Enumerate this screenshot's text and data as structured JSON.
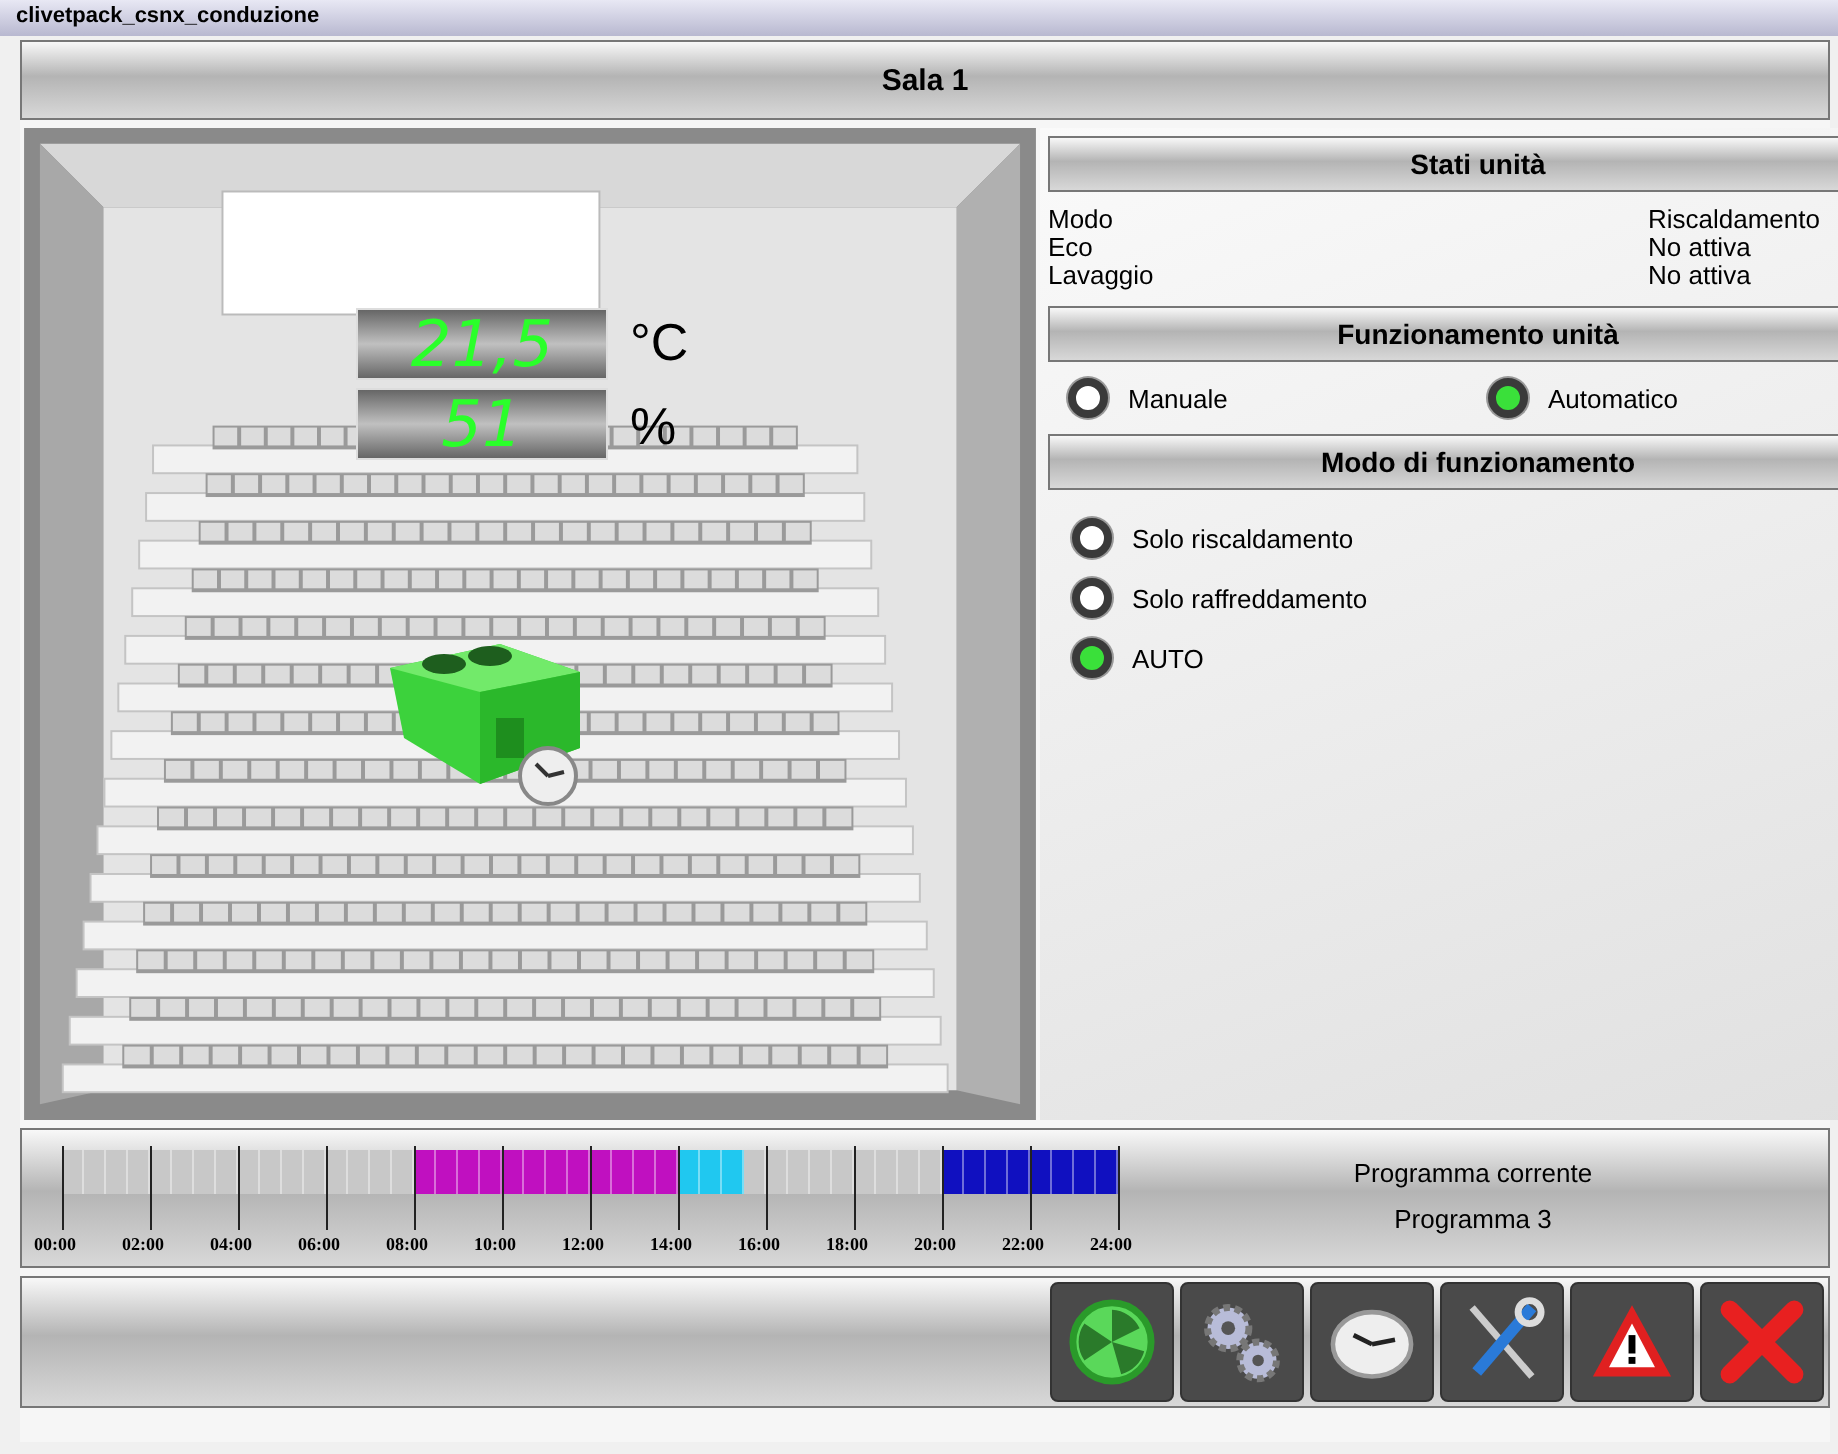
{
  "window": {
    "title": "clivetpack_csnx_conduzione"
  },
  "header": {
    "title": "Sala 1"
  },
  "room": {
    "temperature": {
      "value": "21,5",
      "unit": "°C"
    },
    "humidity": {
      "value": "51",
      "unit": "%"
    }
  },
  "unit_status": {
    "title": "Stati unità",
    "rows": [
      {
        "label": "Modo",
        "value": "Riscaldamento"
      },
      {
        "label": "Eco",
        "value": "No attiva"
      },
      {
        "label": "Lavaggio",
        "value": "No attiva"
      }
    ]
  },
  "unit_operation": {
    "title": "Funzionamento unità",
    "options": [
      {
        "label": "Manuale",
        "selected": false
      },
      {
        "label": "Automatico",
        "selected": true
      }
    ]
  },
  "operating_mode": {
    "title": "Modo di funzionamento",
    "options": [
      {
        "label": "Solo riscaldamento",
        "selected": false
      },
      {
        "label": "Solo raffreddamento",
        "selected": false
      },
      {
        "label": "AUTO",
        "selected": true
      }
    ]
  },
  "schedule": {
    "ticks": [
      "00:00",
      "02:00",
      "04:00",
      "06:00",
      "08:00",
      "10:00",
      "12:00",
      "14:00",
      "16:00",
      "18:00",
      "20:00",
      "22:00",
      "24:00"
    ],
    "slots": [
      {
        "color": "#c8c8c8"
      },
      {
        "color": "#c8c8c8"
      },
      {
        "color": "#c8c8c8"
      },
      {
        "color": "#c8c8c8"
      },
      {
        "color": "#c8c8c8"
      },
      {
        "color": "#c8c8c8"
      },
      {
        "color": "#c8c8c8"
      },
      {
        "color": "#c8c8c8"
      },
      {
        "color": "#c8c8c8"
      },
      {
        "color": "#c8c8c8"
      },
      {
        "color": "#c8c8c8"
      },
      {
        "color": "#c8c8c8"
      },
      {
        "color": "#c8c8c8"
      },
      {
        "color": "#c8c8c8"
      },
      {
        "color": "#c8c8c8"
      },
      {
        "color": "#c8c8c8"
      },
      {
        "color": "#c010c0"
      },
      {
        "color": "#c010c0"
      },
      {
        "color": "#c010c0"
      },
      {
        "color": "#c010c0"
      },
      {
        "color": "#c010c0"
      },
      {
        "color": "#c010c0"
      },
      {
        "color": "#c010c0"
      },
      {
        "color": "#c010c0"
      },
      {
        "color": "#c010c0"
      },
      {
        "color": "#c010c0"
      },
      {
        "color": "#c010c0"
      },
      {
        "color": "#c010c0"
      },
      {
        "color": "#20c8f0"
      },
      {
        "color": "#20c8f0"
      },
      {
        "color": "#20c8f0"
      },
      {
        "color": "#c8c8c8"
      },
      {
        "color": "#c8c8c8"
      },
      {
        "color": "#c8c8c8"
      },
      {
        "color": "#c8c8c8"
      },
      {
        "color": "#c8c8c8"
      },
      {
        "color": "#c8c8c8"
      },
      {
        "color": "#c8c8c8"
      },
      {
        "color": "#c8c8c8"
      },
      {
        "color": "#c8c8c8"
      },
      {
        "color": "#1010c0"
      },
      {
        "color": "#1010c0"
      },
      {
        "color": "#1010c0"
      },
      {
        "color": "#1010c0"
      },
      {
        "color": "#1010c0"
      },
      {
        "color": "#1010c0"
      },
      {
        "color": "#1010c0"
      },
      {
        "color": "#1010c0"
      }
    ],
    "program_label": "Programma corrente",
    "program_name": "Programma 3"
  }
}
